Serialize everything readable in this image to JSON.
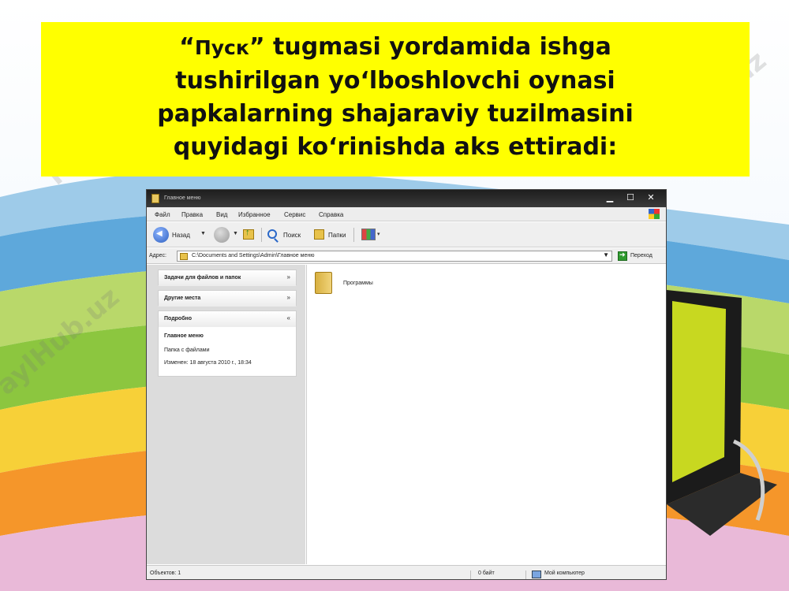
{
  "headline": {
    "open_quote": "“",
    "pusk": "Пуск",
    "close_quote": "”",
    "line1_rest": " tugmasi yordamida ishga",
    "line2": "tushirilgan yo‘lboshlovchi oynasi",
    "line3": "papkalarning shajaraviy tuzilmasini",
    "line4": "quyidagi ko‘rinishda aks ettiradi:"
  },
  "watermark": "FaylHub.uz",
  "window": {
    "title": "Главное меню",
    "controls": {
      "minimize": "▁",
      "maximize": "☐",
      "close": "✕"
    },
    "menu": [
      "Файл",
      "Правка",
      "Вид",
      "Избранное",
      "Сервис",
      "Справка"
    ],
    "toolbar": {
      "back": "Назад",
      "search": "Поиск",
      "folders": "Папки"
    },
    "address": {
      "label": "Адрес:",
      "value": "C:\\Documents and Settings\\Admin\\Главное меню",
      "go": "Переход"
    },
    "panels": {
      "tasks": "Задачи для файлов и папок",
      "other_places": "Другие места",
      "details": "Подробно",
      "details_name": "Главное меню",
      "details_type": "Папка с файлами",
      "details_modified": "Изменен: 18 августа 2010 г., 18:34"
    },
    "content": {
      "items": [
        {
          "label": "Программы",
          "icon": "folder-icon"
        }
      ]
    },
    "status": {
      "objects": "Объектов: 1",
      "size": "0 байт",
      "location": "Мой компьютер"
    }
  }
}
